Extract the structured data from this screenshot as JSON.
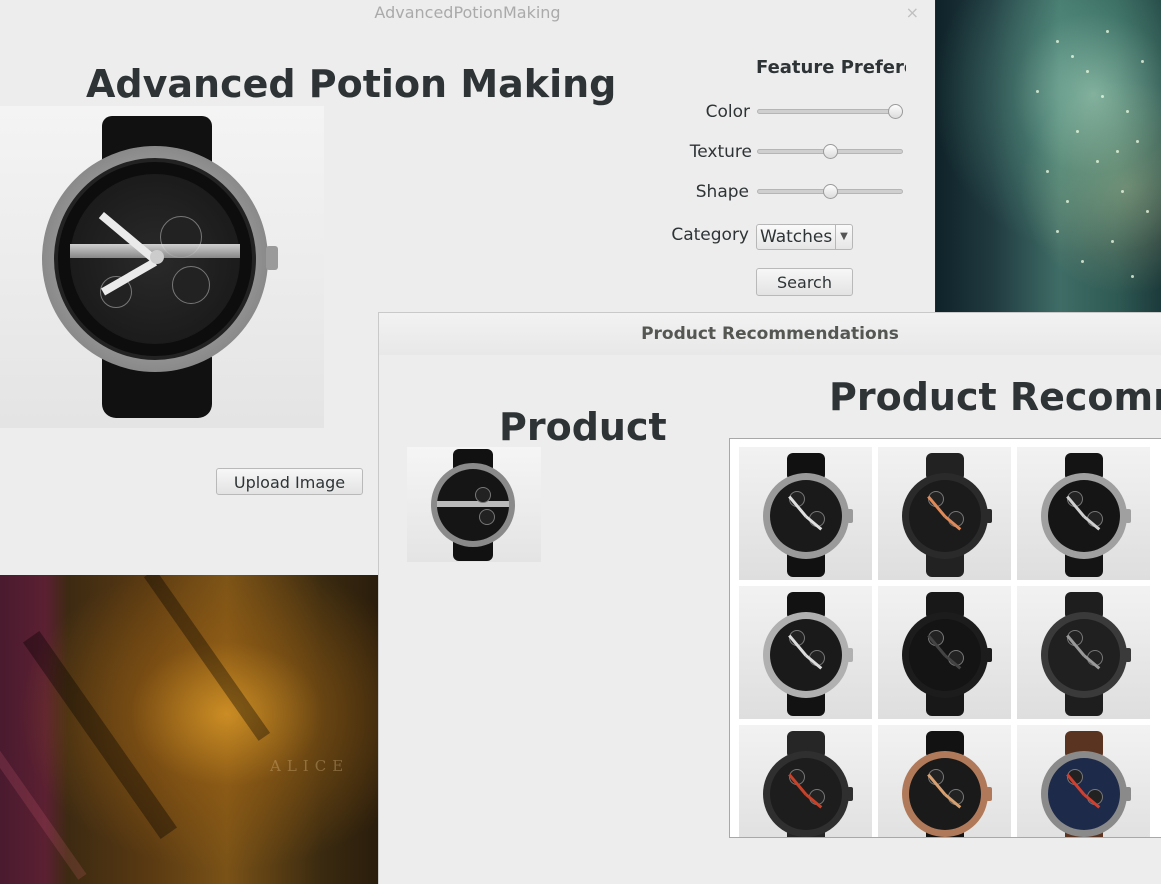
{
  "main_window": {
    "title": "AdvancedPotionMaking",
    "close_glyph": "×",
    "app_title": "Advanced Potion Making",
    "upload_button": "Upload Image",
    "preferences": {
      "title": "Feature Preferences",
      "color_label": "Color",
      "color_value": 1.0,
      "texture_label": "Texture",
      "texture_value": 0.5,
      "shape_label": "Shape",
      "shape_value": 0.5,
      "category_label": "Category",
      "category_value": "Watches",
      "search_button": "Search"
    }
  },
  "rec_window": {
    "title": "Product Recommendations",
    "product_label": "Product",
    "heading": "Product Recommendations",
    "items": [
      {
        "dial": "#1a1a1a",
        "case": "#9a9a9a",
        "strap": "#111111",
        "accent": "#e0e0e0"
      },
      {
        "dial": "#1b1b1b",
        "case": "#2a2a2a",
        "strap": "#222222",
        "accent": "#e08a5a"
      },
      {
        "dial": "#151515",
        "case": "#a0a0a0",
        "strap": "#141414",
        "accent": "#cfcfcf"
      },
      {
        "dial": "#1a1a1a",
        "case": "#b0b0b0",
        "strap": "#121212",
        "accent": "#dcdcdc"
      },
      {
        "dial": "#141414",
        "case": "#1c1c1c",
        "strap": "#181818",
        "accent": "#444444"
      },
      {
        "dial": "#202020",
        "case": "#3a3a3a",
        "strap": "#1e1e1e",
        "accent": "#9a9a9a"
      },
      {
        "dial": "#1d1d1d",
        "case": "#2f2f2f",
        "strap": "#262626",
        "accent": "#c8422a"
      },
      {
        "dial": "#1a1a1a",
        "case": "#b07a5a",
        "strap": "#121212",
        "accent": "#d8a070"
      },
      {
        "dial": "#1d2a4a",
        "case": "#8a8a8a",
        "strap": "#5a3420",
        "accent": "#d04030"
      }
    ]
  },
  "icons": {
    "main_photo": "watch-photo-icon",
    "thumb": "watch-thumbnail-icon"
  }
}
